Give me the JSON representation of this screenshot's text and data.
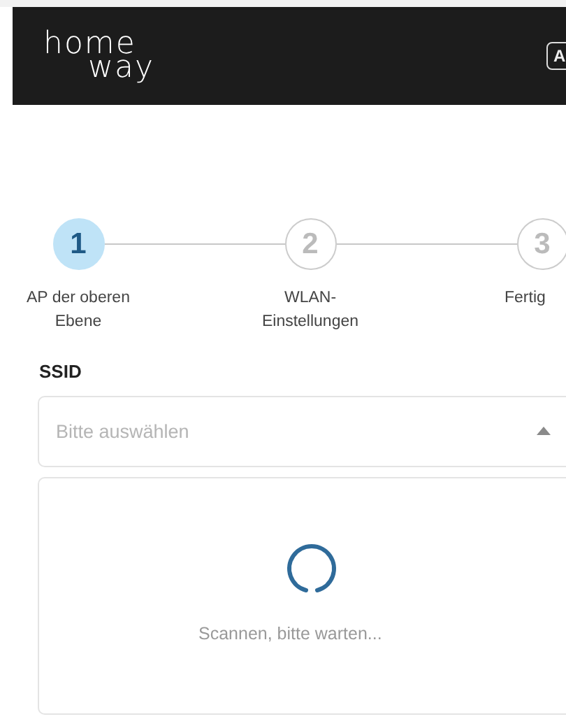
{
  "header": {
    "logo_top": "home",
    "logo_bottom": "way",
    "language_label": "A"
  },
  "steps": [
    {
      "number": "1",
      "label": "AP der oberen Ebene",
      "selected": true
    },
    {
      "number": "2",
      "label": "WLAN-Einstellungen",
      "selected": false
    },
    {
      "number": "3",
      "label": "Fertig",
      "selected": false
    }
  ],
  "ssid": {
    "label": "SSID",
    "placeholder": "Bitte auswählen",
    "expanded": true
  },
  "dropdown": {
    "message": "Scannen, bitte warten..."
  }
}
